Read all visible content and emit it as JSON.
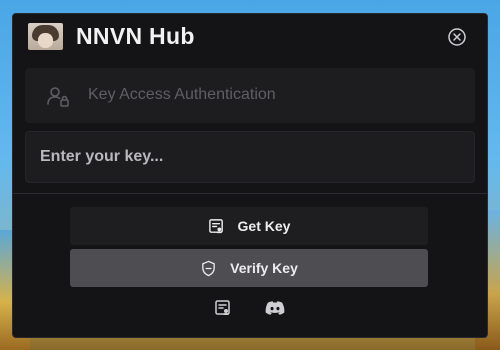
{
  "window": {
    "title": "NNVN Hub",
    "avatar": "user-avatar"
  },
  "auth": {
    "label": "Key Access Authentication",
    "icon": "user-lock-icon"
  },
  "key_input": {
    "value": "",
    "placeholder": "Enter your key..."
  },
  "buttons": {
    "get_key": {
      "label": "Get Key",
      "icon": "key-document-icon"
    },
    "verify_key": {
      "label": "Verify Key",
      "icon": "shield-icon"
    }
  },
  "footer": {
    "icons": [
      "key-document-icon",
      "discord-icon"
    ]
  },
  "colors": {
    "panel_bg": "#141416",
    "card_bg": "#1d1d20",
    "verify_button_bg": "#4d4d52",
    "text": "#f2f2f2",
    "muted_text": "#5f5f64"
  }
}
